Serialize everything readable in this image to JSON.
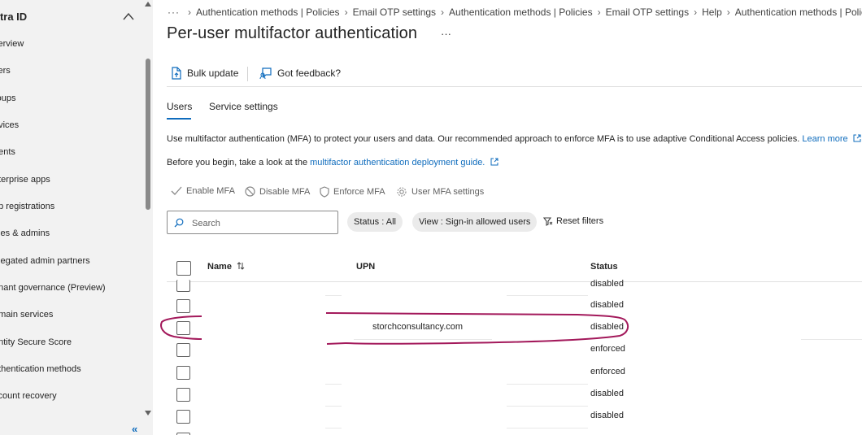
{
  "sidebar": {
    "title": "ntra ID",
    "items": [
      {
        "label": "verview"
      },
      {
        "label": "sers"
      },
      {
        "label": "roups"
      },
      {
        "label": "evices"
      },
      {
        "label": "gents"
      },
      {
        "label": "nterprise apps"
      },
      {
        "label": "pp registrations"
      },
      {
        "label": "oles & admins"
      },
      {
        "label": "elegated admin partners"
      },
      {
        "label": "enant governance (Preview)"
      },
      {
        "label": "omain services"
      },
      {
        "label": "entity Secure Score"
      },
      {
        "label": "uthentication methods"
      },
      {
        "label": "ccount recovery"
      }
    ],
    "collapse_glyph": "«"
  },
  "breadcrumb": {
    "dots": "···",
    "items": [
      "Authentication methods | Policies",
      "Email OTP settings",
      "Authentication methods | Policies",
      "Email OTP settings",
      "Help",
      "Authentication methods | Policies"
    ]
  },
  "header": {
    "title": "Per-user multifactor authentication",
    "more": "···"
  },
  "toolbar": {
    "bulk_update": "Bulk update",
    "feedback": "Got feedback?"
  },
  "tabs": {
    "users": "Users",
    "service_settings": "Service settings"
  },
  "info": {
    "line1": "Use multifactor authentication (MFA) to protect your users and data. Our recommended approach to enforce MFA is to use adaptive Conditional Access policies.",
    "learn_more": "Learn more",
    "line2_prefix": "Before you begin, take a look at the",
    "deploy_link": "multifactor authentication deployment guide."
  },
  "actions": {
    "enable": "Enable MFA",
    "disable": "Disable MFA",
    "enforce": "Enforce MFA",
    "settings": "User MFA settings"
  },
  "filters": {
    "search_placeholder": "Search",
    "status": "Status : All",
    "view": "View : Sign-in allowed users",
    "reset": "Reset filters"
  },
  "table": {
    "headers": {
      "name": "Name",
      "upn": "UPN",
      "status": "Status"
    },
    "rows": [
      {
        "upn": "",
        "status": "disabled"
      },
      {
        "upn": "",
        "status": "disabled"
      },
      {
        "upn": "storchconsultancy.com",
        "status": "disabled"
      },
      {
        "upn": "",
        "status": "enforced"
      },
      {
        "upn": "",
        "status": "enforced"
      },
      {
        "upn": "",
        "status": "disabled"
      },
      {
        "upn": "",
        "status": "disabled"
      }
    ]
  },
  "colors": {
    "accent": "#0f6cbd",
    "annotation": "#a3195b",
    "sidebar_bg": "#f2f2f2"
  }
}
